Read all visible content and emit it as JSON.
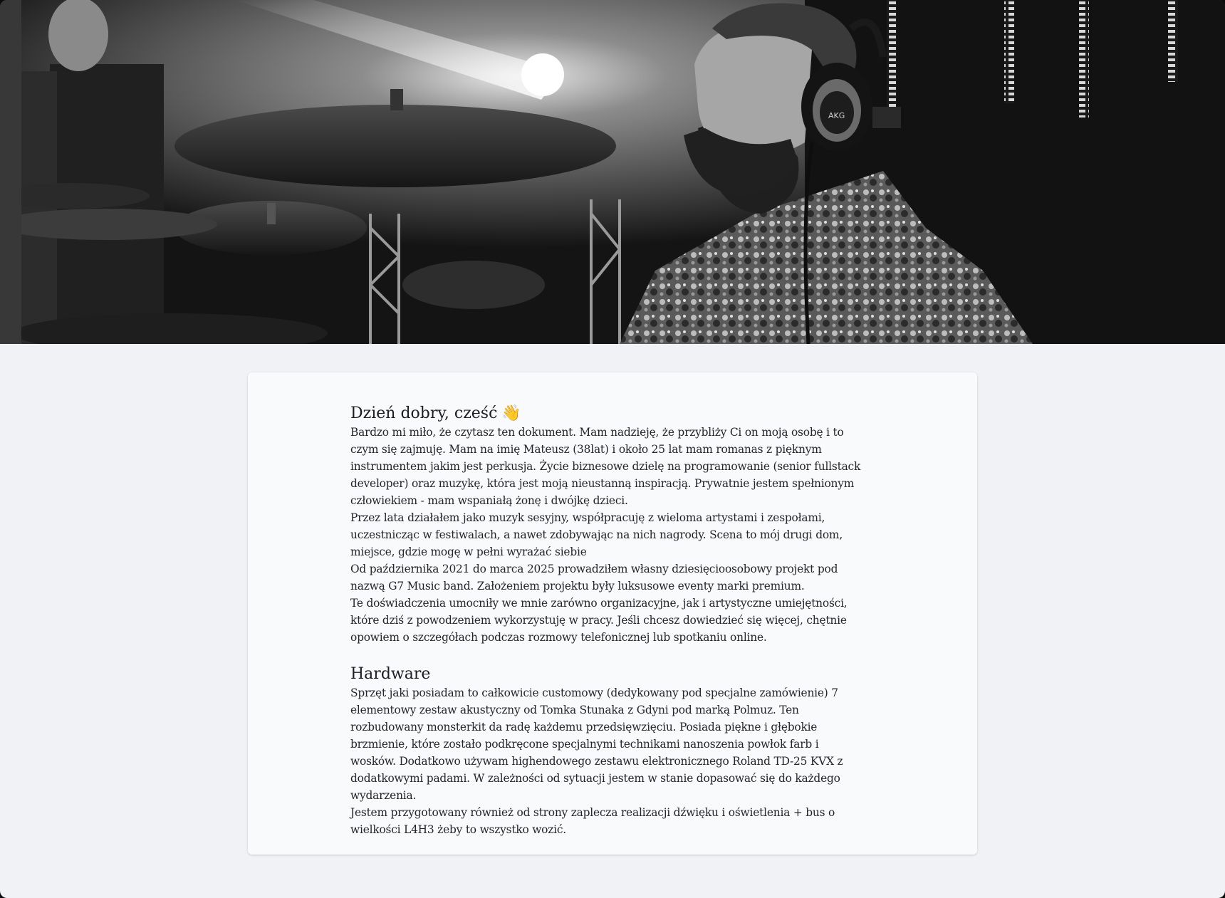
{
  "intro": {
    "heading": "Dzień dobry, cześć",
    "wave_icon": "waving-hand-icon",
    "paragraphs": [
      "Bardzo mi miło, że czytasz ten dokument. Mam nadzieję, że przybliży Ci on moją osobę i to czym się zajmuję. Mam na imię Mateusz (38lat) i około 25 lat mam romanas z pięknym instrumentem jakim jest perkusja. Życie biznesowe dzielę na programowanie (senior fullstack developer) oraz muzykę, która jest moją nieustanną inspiracją. Prywatnie jestem spełnionym człowiekiem - mam wspaniałą żonę i dwójkę dzieci.",
      "Przez lata działałem jako muzyk sesyjny, współpracuję z wieloma artystami i zespołami, uczestnicząc w festiwalach, a nawet zdobywając na nich nagrody. Scena to mój drugi dom, miejsce, gdzie mogę w pełni wyrażać siebie",
      "Od października 2021 do marca 2025 prowadziłem własny dziesięcioosobowy projekt pod nazwą G7 Music band. Założeniem projektu były luksusowe eventy marki premium.",
      "Te doświadczenia umocniły we mnie zarówno organizacyjne, jak i artystyczne umiejętności, które dziś z powodzeniem wykorzystuję w pracy. Jeśli chcesz dowiedzieć się więcej, chętnie opowiem o szczegółach podczas rozmowy telefonicznej lub spotkaniu online."
    ]
  },
  "hardware": {
    "heading": "Hardware",
    "paragraphs": [
      "Sprzęt jaki posiadam to całkowicie customowy (dedykowany pod specjalne zamówienie) 7 elementowy zestaw akustyczny od Tomka Stunaka z Gdyni pod marką Polmuz. Ten rozbudowany monsterkit da radę każdemu przedsięwzięciu. Posiada piękne i głębokie brzmienie, które zostało podkręcone specjalnymi technikami nanoszenia powłok farb i wosków. Dodatkowo używam highendowego zestawu elektronicznego Roland TD-25 KVX z dodatkowymi padami. W zależności od sytuacji jestem w stanie dopasować się do każdego wydarzenia.",
      "Jestem przygotowany również od strony zaplecza realizacji dźwięku i oświetlenia + bus o wielkości L4H3 żeby to wszystko wozić."
    ]
  },
  "hero": {
    "headphones_brand": "AKG"
  }
}
